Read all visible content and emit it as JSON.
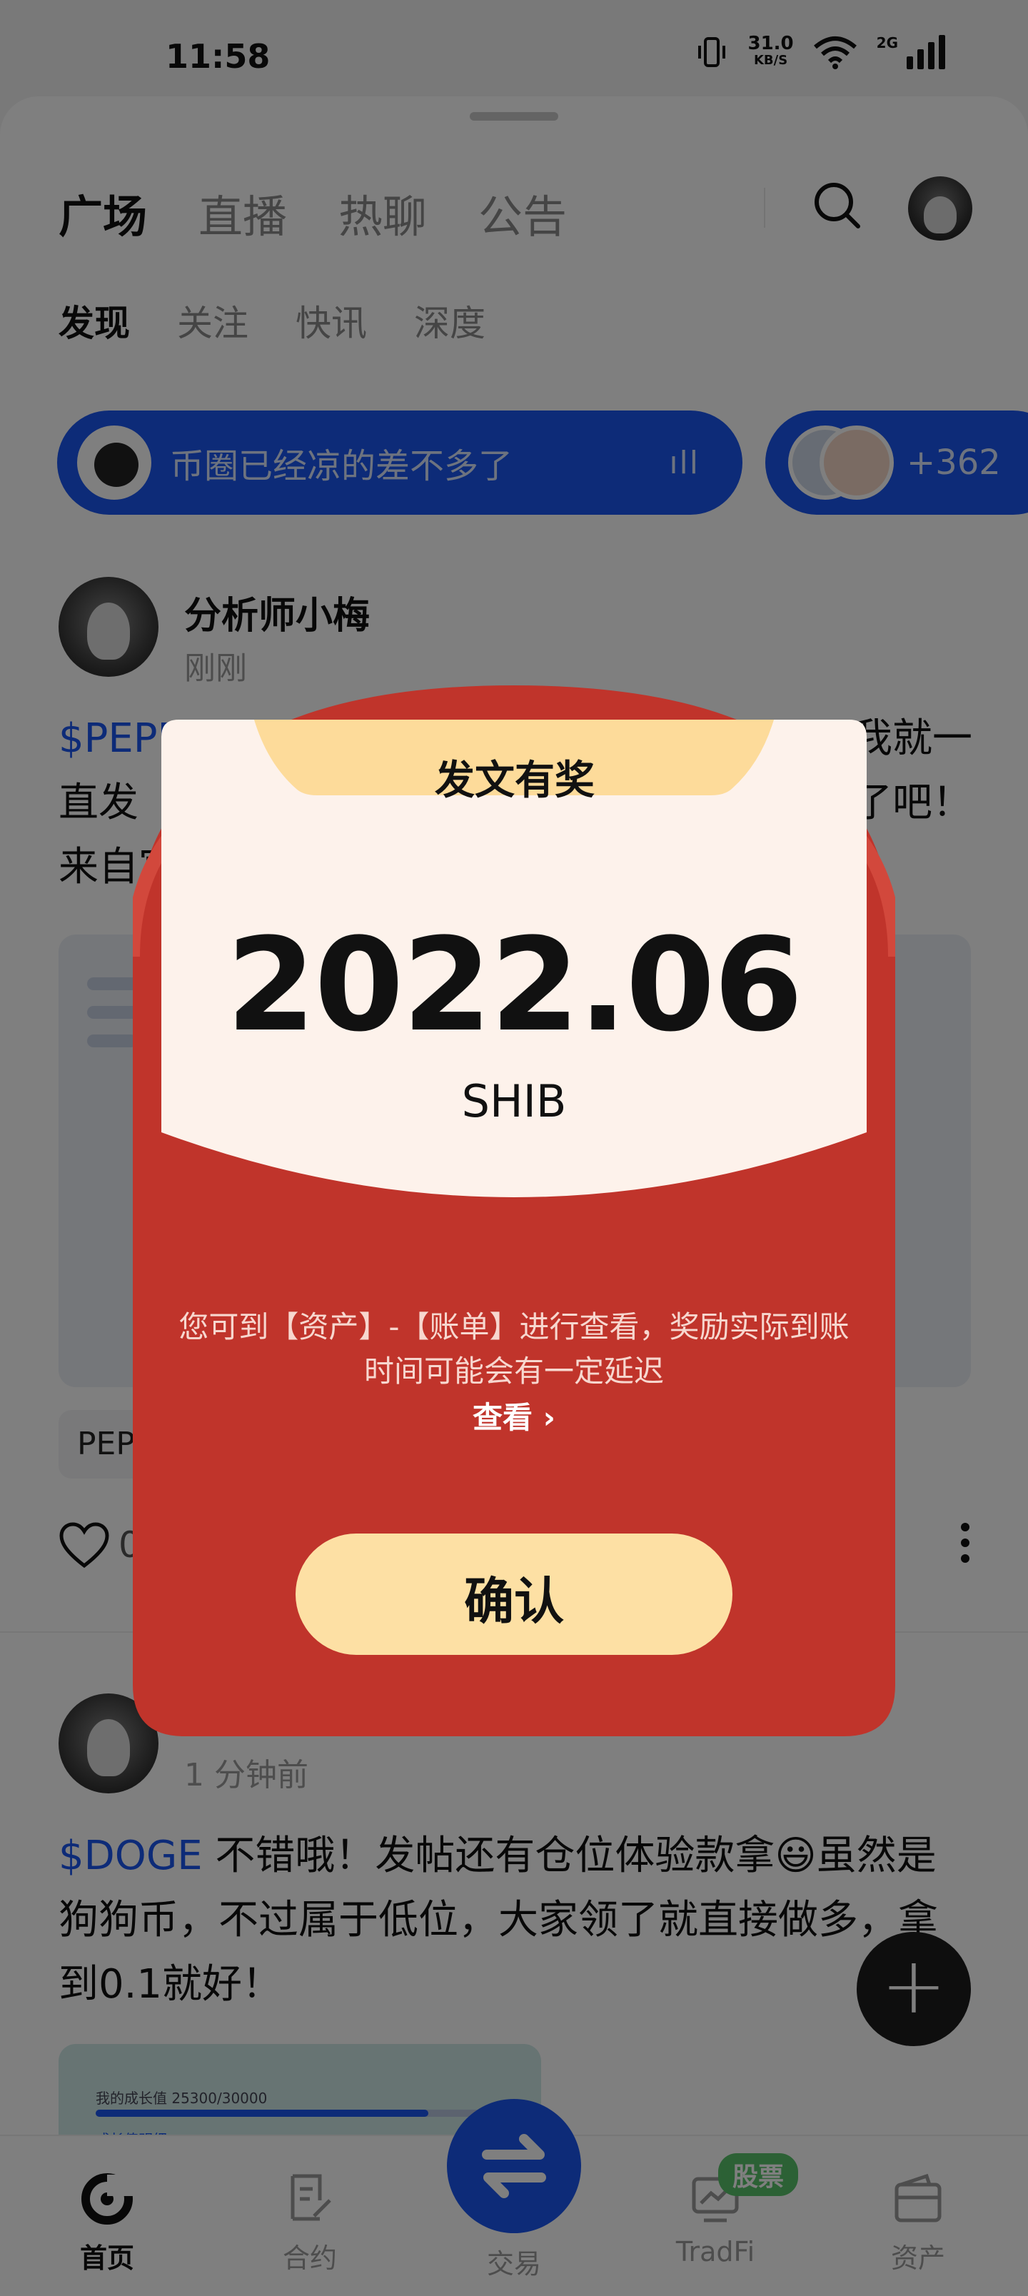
{
  "status_bar": {
    "time": "11:58",
    "net_speed": "31.0",
    "net_unit": "KB/S",
    "net_type": "2G"
  },
  "main_tabs": [
    "广场",
    "直播",
    "热聊",
    "公告"
  ],
  "sub_tabs": [
    "发现",
    "关注",
    "快讯",
    "深度"
  ],
  "live_rooms": [
    {
      "title": "币圈已经凉的差不多了",
      "wave": "ıll"
    },
    {
      "count": "+362"
    }
  ],
  "posts": [
    {
      "author": "分析师小梅",
      "time": "刚刚",
      "tag": "$PEPE",
      "body_left": "直发",
      "body_right_1": "我就一",
      "body_right_2": "了吧！",
      "body_left_3": "来自官",
      "chip": "PEPE",
      "likes": "0"
    },
    {
      "author": "",
      "time": "1 分钟前",
      "tag": "$DOGE",
      "body": " 不错哦！发帖还有仓位体验款拿😃虽然是狗狗币，不过属于低位，大家领了就直接做多，拿到0.1就好！",
      "image_text_1": "我的成长值 25300/30000",
      "image_text_2": "成长值明细 ›"
    }
  ],
  "bottom_nav": [
    {
      "label": "首页",
      "icon": "home-icon"
    },
    {
      "label": "合约",
      "icon": "contract-icon"
    },
    {
      "label": "交易",
      "icon": "swap-icon"
    },
    {
      "label": "TradFi",
      "icon": "tradfi-icon"
    },
    {
      "label": "资产",
      "icon": "wallet-icon"
    }
  ],
  "stock_badge": "股票",
  "fab_symbol": "+",
  "reward_modal": {
    "title": "发文有奖",
    "amount": "2022.06",
    "unit": "SHIB",
    "note": "您可到【资产】-【账单】进行查看，奖励实际到账时间可能会有一定延迟",
    "view_label": "查看 ›",
    "confirm_label": "确认"
  },
  "colors": {
    "brand_blue": "#1b56f0",
    "packet_red": "#c0342b",
    "card_cream": "#fdf2eb",
    "button_gold": "#fde0a4"
  }
}
